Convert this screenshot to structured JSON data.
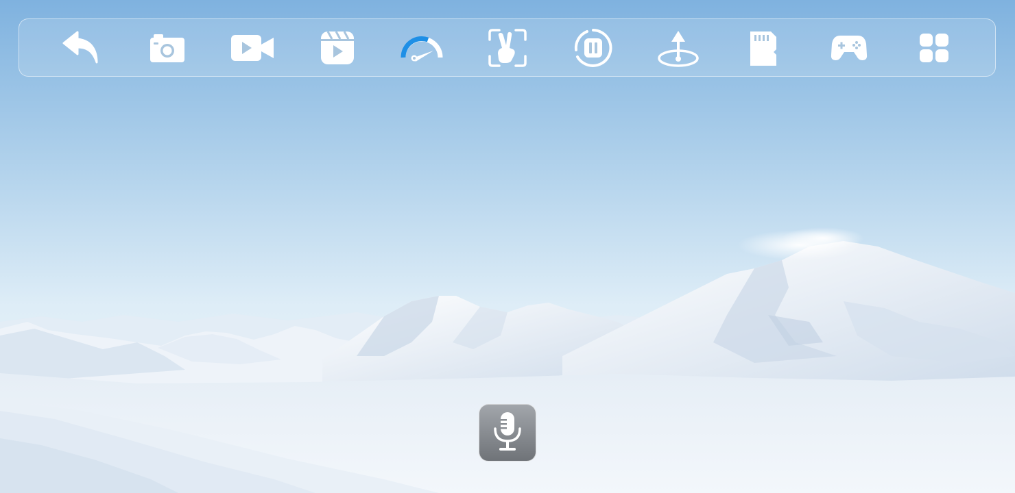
{
  "scene": {
    "background": "snowy-mountain-landscape",
    "sky_top": "#7eb3e0",
    "sky_horizon": "#e4f0f8",
    "snow": "#f4f8fc"
  },
  "toolbar": {
    "items": [
      {
        "id": "back",
        "icon": "back-arrow-icon"
      },
      {
        "id": "photo",
        "icon": "camera-icon"
      },
      {
        "id": "video",
        "icon": "video-camera-icon"
      },
      {
        "id": "clips",
        "icon": "clapperboard-play-icon"
      },
      {
        "id": "speed",
        "icon": "speedometer-icon"
      },
      {
        "id": "gesture",
        "icon": "gesture-recognition-icon"
      },
      {
        "id": "pause",
        "icon": "pause-circle-icon"
      },
      {
        "id": "takeoff",
        "icon": "takeoff-landing-icon"
      },
      {
        "id": "storage",
        "icon": "sd-card-icon"
      },
      {
        "id": "controller",
        "icon": "gamepad-icon"
      },
      {
        "id": "more",
        "icon": "apps-grid-icon"
      }
    ],
    "icon_color": "#ffffff",
    "accent_color": "#1e8fe6"
  },
  "voice": {
    "icon": "microphone-icon"
  }
}
